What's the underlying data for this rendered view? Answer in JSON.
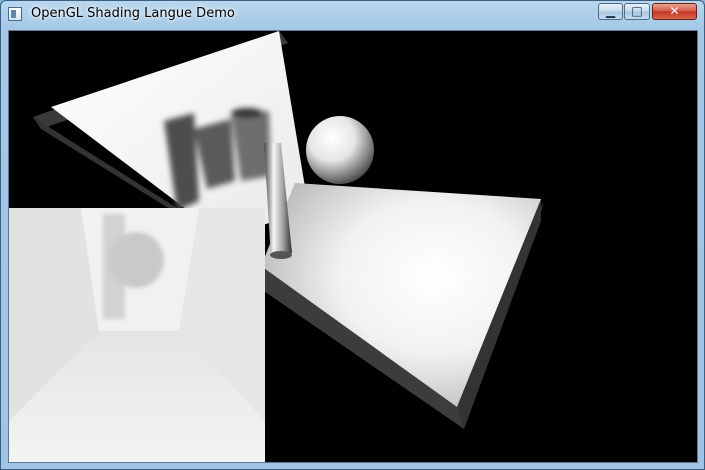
{
  "window": {
    "title": "OpenGL Shading Langue Demo",
    "icon": "app-window-icon"
  },
  "controls": {
    "minimize_icon": "minimize-icon",
    "maximize_icon": "maximize-icon",
    "close_icon": "close-icon"
  },
  "scene": {
    "background_color": "#000000",
    "objects": [
      "back-wall",
      "floor-slab",
      "sphere",
      "cylinder",
      "shadow-map-preview"
    ]
  },
  "colors": {
    "titlebar": "#a4c8e6",
    "close_button": "#c23523"
  }
}
